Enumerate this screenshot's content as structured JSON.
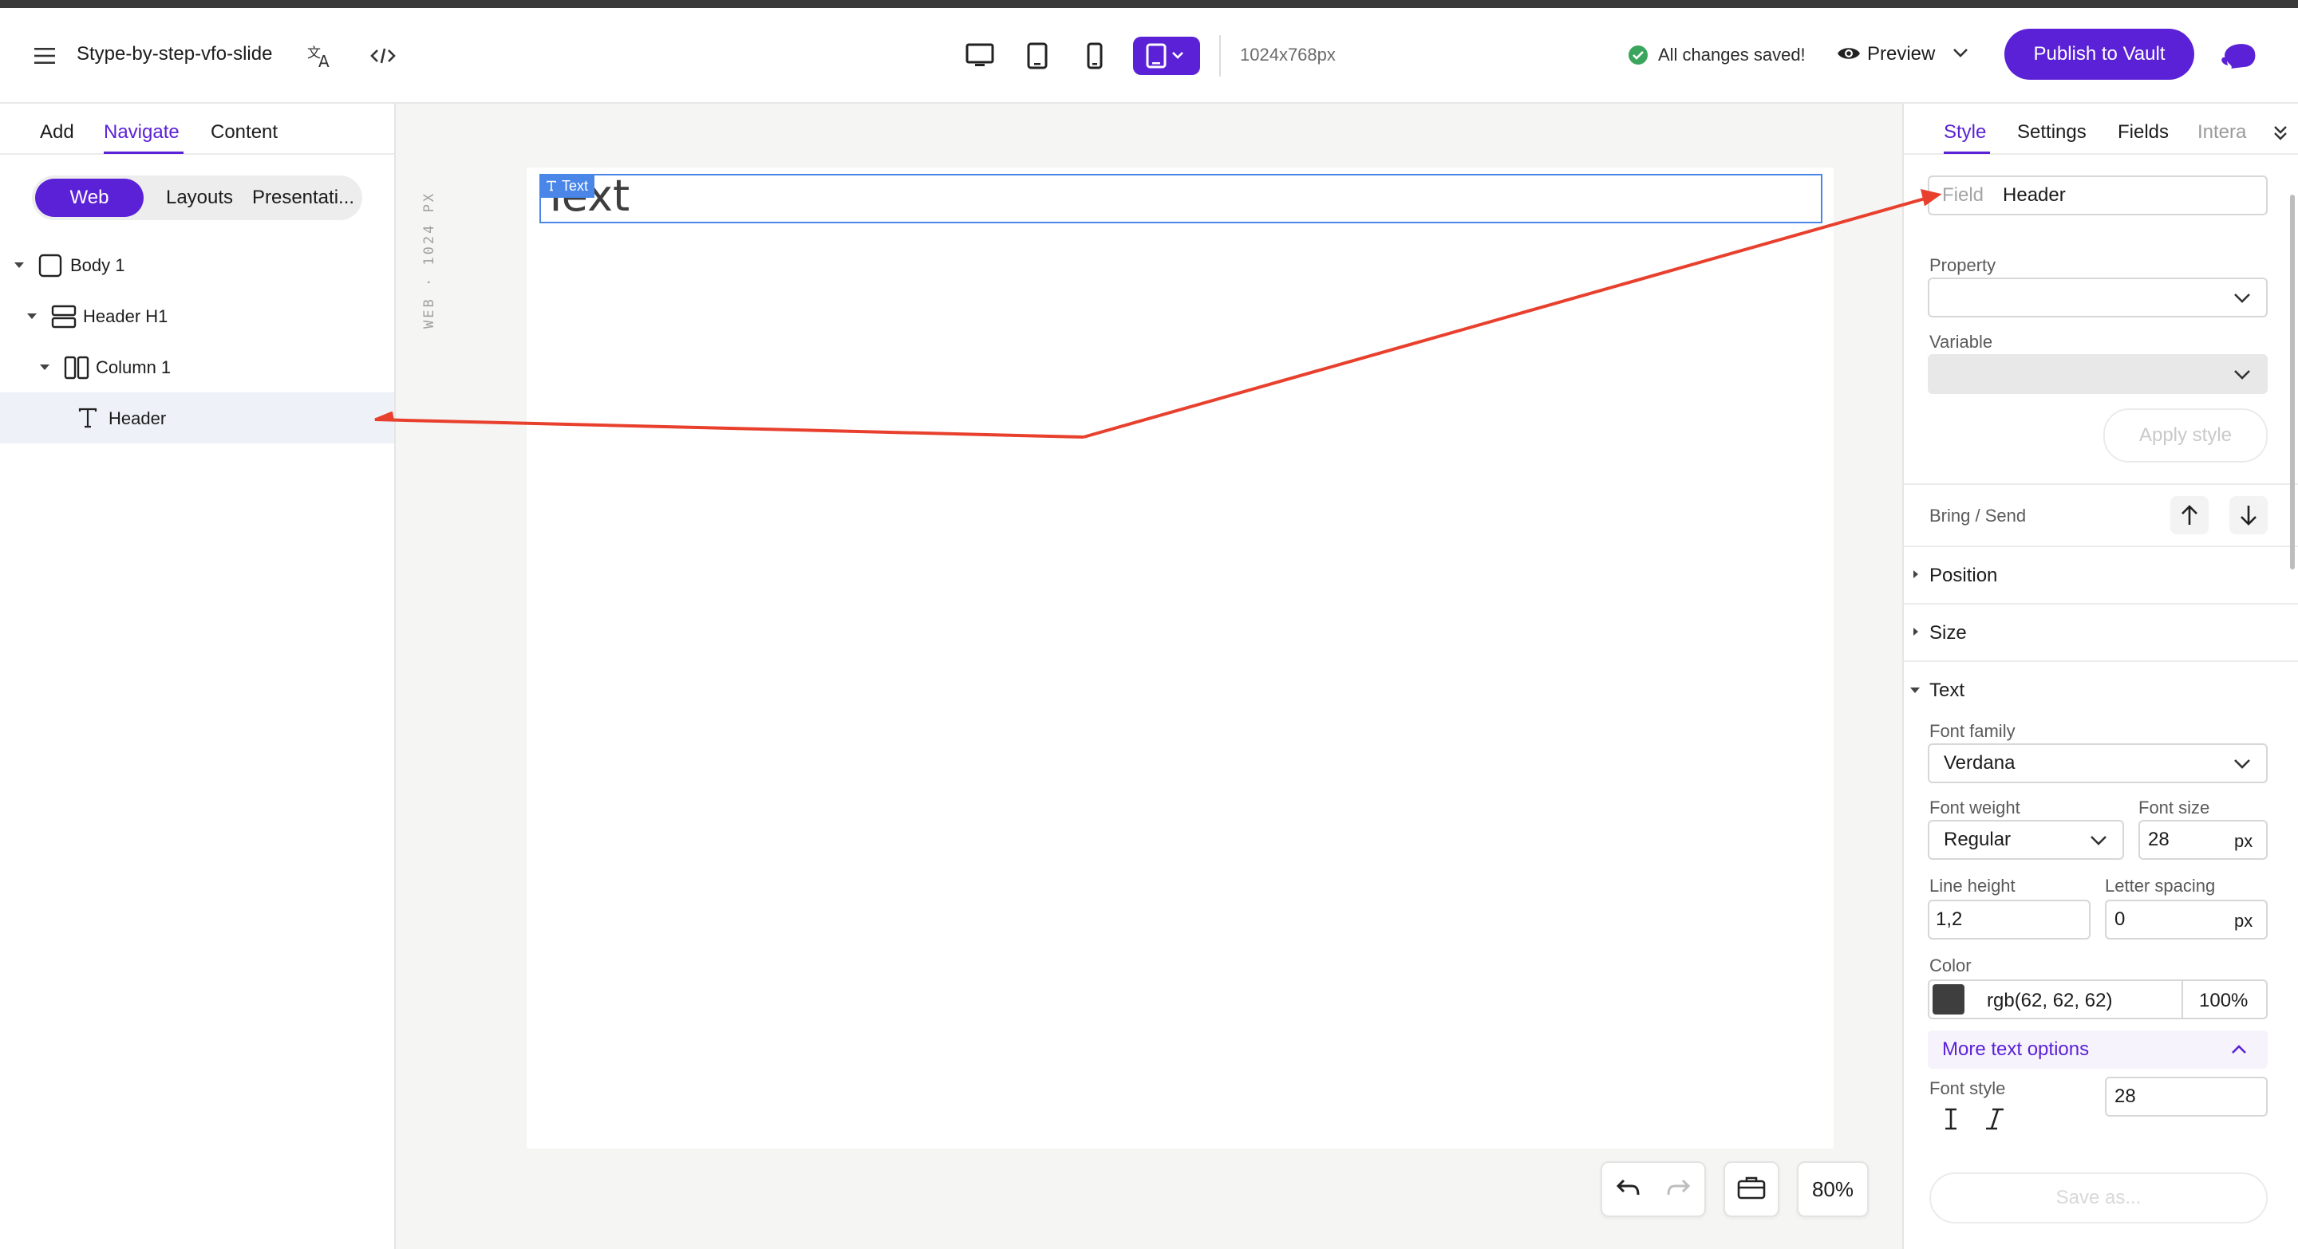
{
  "header": {
    "doc_title": "Stype-by-step-vfo-slide",
    "dimensions": "1024x768px",
    "status": "All changes saved!",
    "preview_label": "Preview",
    "publish_label": "Publish to Vault"
  },
  "left_panel": {
    "tabs": [
      "Add",
      "Navigate",
      "Content"
    ],
    "active_tab": "Navigate",
    "segments": [
      "Web",
      "Layouts",
      "Presentati..."
    ],
    "active_segment": "Web",
    "tree": [
      {
        "label": "Body 1",
        "icon": "body-icon"
      },
      {
        "label": "Header H1",
        "icon": "section-icon"
      },
      {
        "label": "Column 1",
        "icon": "column-icon"
      },
      {
        "label": "Header",
        "icon": "text-icon",
        "selected": true
      }
    ]
  },
  "canvas": {
    "ruler_label": "WEB · 1024 PX",
    "selection_tag": "Text",
    "element_text": "Text",
    "zoom": "80%"
  },
  "right_panel": {
    "tabs": [
      "Style",
      "Settings",
      "Fields",
      "Intera"
    ],
    "active_tab": "Style",
    "field_label": "Field",
    "field_value": "Header",
    "property_label": "Property",
    "property_value": "",
    "variable_label": "Variable",
    "variable_value": "",
    "apply_style": "Apply style",
    "bring_send": "Bring / Send",
    "sections": {
      "position": "Position",
      "size": "Size",
      "text": "Text"
    },
    "font_family_label": "Font family",
    "font_family": "Verdana",
    "font_weight_label": "Font weight",
    "font_weight": "Regular",
    "font_size_label": "Font size",
    "font_size": "28",
    "font_size_unit": "px",
    "line_height_label": "Line height",
    "line_height": "1,2",
    "letter_spacing_label": "Letter spacing",
    "letter_spacing": "0",
    "letter_spacing_unit": "px",
    "color_label": "Color",
    "color_value": "rgb(62, 62, 62)",
    "color_hex": "#3e3e3e",
    "opacity": "100%",
    "more_text_options": "More text options",
    "font_style_label": "Font style",
    "font_style_value": "28",
    "save_as": "Save as..."
  },
  "colors": {
    "accent": "#5b21d6",
    "selection": "#4a86e8",
    "annotation_arrow": "#e8402d",
    "success": "#3aa55d"
  }
}
